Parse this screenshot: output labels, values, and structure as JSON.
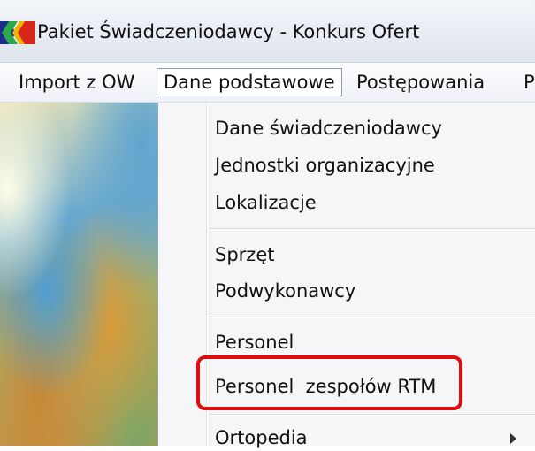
{
  "window": {
    "title": "Pakiet Świadczeniodawcy - Konkurs Ofert",
    "icon": "app-logo-icon"
  },
  "menubar": {
    "items": [
      {
        "label": "Import z OW"
      },
      {
        "label": "Dane podstawowe",
        "active": true
      },
      {
        "label": "Postępowania"
      },
      {
        "label": "P"
      }
    ]
  },
  "dropdown": {
    "items": [
      {
        "label": "Dane świadczeniodawcy"
      },
      {
        "label": "Jednostki organizacyjne"
      },
      {
        "label": "Lokalizacje"
      },
      {
        "label": "Sprzęt"
      },
      {
        "label": "Podwykonawcy"
      },
      {
        "label": "Personel"
      },
      {
        "label": "Personel  zespołów RTM",
        "highlighted": true
      },
      {
        "label": "Ortopedia",
        "has_submenu": true
      }
    ]
  },
  "colors": {
    "highlight_border": "#e00d0d",
    "menu_background": "#f6f6f8"
  }
}
